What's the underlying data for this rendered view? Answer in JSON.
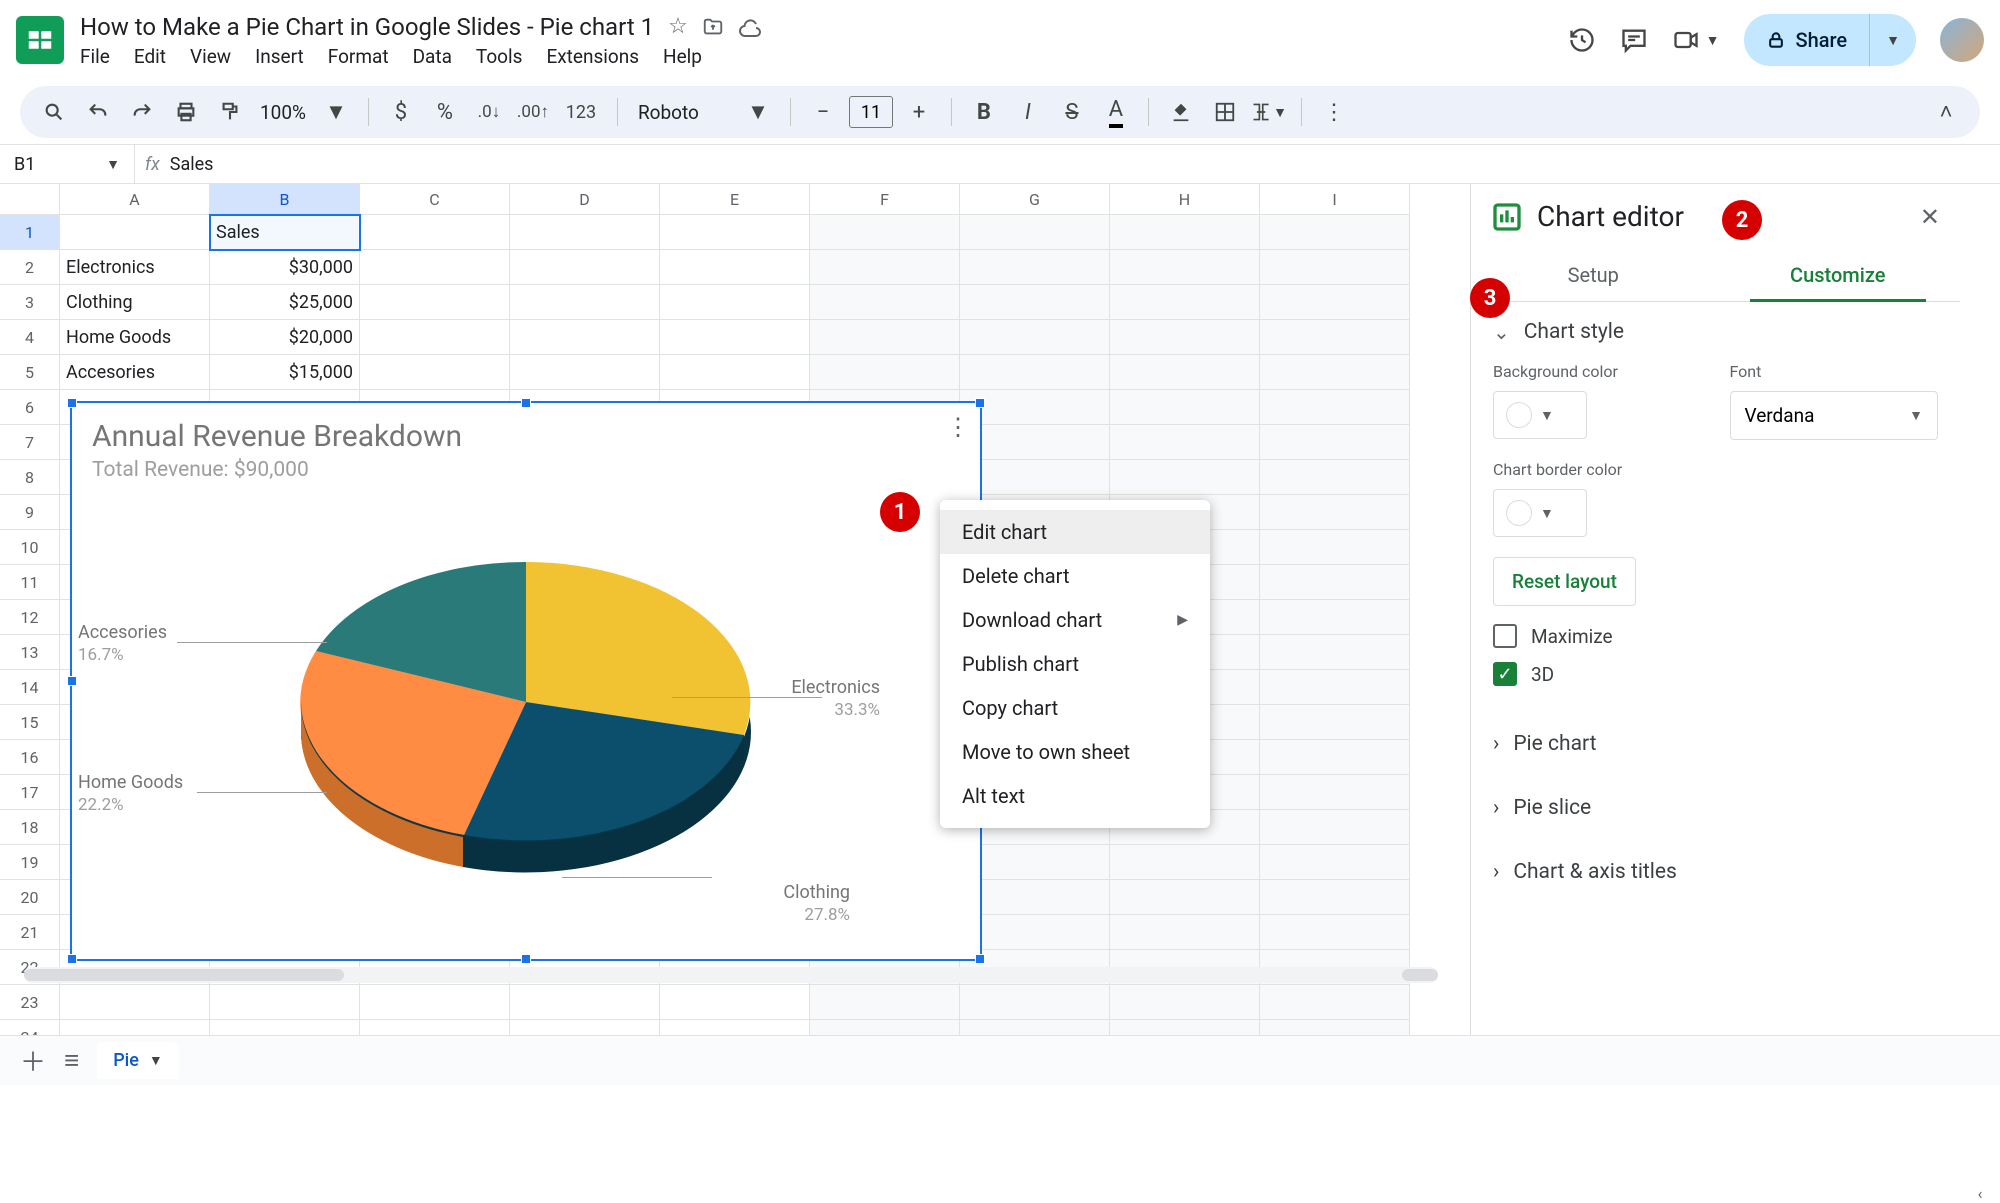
{
  "doc_title": "How to Make a Pie Chart in Google Slides - Pie chart 1",
  "menus": [
    "File",
    "Edit",
    "View",
    "Insert",
    "Format",
    "Data",
    "Tools",
    "Extensions",
    "Help"
  ],
  "share_label": "Share",
  "toolbar": {
    "zoom": "100%",
    "font": "Roboto",
    "font_size": "11",
    "num_fmt": "123"
  },
  "name_box": "B1",
  "formula": "Sales",
  "columns": [
    "A",
    "B",
    "C",
    "D",
    "E",
    "F",
    "G",
    "H",
    "I"
  ],
  "rows": [
    {
      "n": "1",
      "A": "",
      "B": "Sales"
    },
    {
      "n": "2",
      "A": "Electronics",
      "B": "$30,000"
    },
    {
      "n": "3",
      "A": "Clothing",
      "B": "$25,000"
    },
    {
      "n": "4",
      "A": "Home Goods",
      "B": "$20,000"
    },
    {
      "n": "5",
      "A": "Accesories",
      "B": "$15,000"
    }
  ],
  "chart": {
    "title": "Annual Revenue Breakdown",
    "subtitle": "Total Revenue: $90,000"
  },
  "chart_data": {
    "type": "pie",
    "title": "Annual Revenue Breakdown",
    "subtitle": "Total Revenue: $90,000",
    "series": [
      {
        "name": "Electronics",
        "value": 30000,
        "pct": 33.3,
        "color": "#f1c232"
      },
      {
        "name": "Clothing",
        "value": 25000,
        "pct": 27.8,
        "color": "#0b4f6c"
      },
      {
        "name": "Home Goods",
        "value": 20000,
        "pct": 22.2,
        "color": "#ff8c42"
      },
      {
        "name": "Accesories",
        "value": 15000,
        "pct": 16.7,
        "color": "#2a7a7a"
      }
    ],
    "is_3d": true
  },
  "pie_labels": {
    "electronics": {
      "name": "Electronics",
      "pct": "33.3%"
    },
    "clothing": {
      "name": "Clothing",
      "pct": "27.8%"
    },
    "homegoods": {
      "name": "Home Goods",
      "pct": "22.2%"
    },
    "accesories": {
      "name": "Accesories",
      "pct": "16.7%"
    }
  },
  "context_menu": [
    "Edit chart",
    "Delete chart",
    "Download chart",
    "Publish chart",
    "Copy chart",
    "Move to own sheet",
    "Alt text"
  ],
  "sidebar": {
    "title": "Chart editor",
    "tabs": {
      "setup": "Setup",
      "customize": "Customize"
    },
    "style_section": "Chart style",
    "bg_label": "Background color",
    "font_label": "Font",
    "font_value": "Verdana",
    "border_label": "Chart border color",
    "reset": "Reset layout",
    "maximize": "Maximize",
    "three_d": "3D",
    "sections": [
      "Pie chart",
      "Pie slice",
      "Chart & axis titles"
    ]
  },
  "sheet_tab": "Pie",
  "markers": {
    "1": "1",
    "2": "2",
    "3": "3"
  }
}
